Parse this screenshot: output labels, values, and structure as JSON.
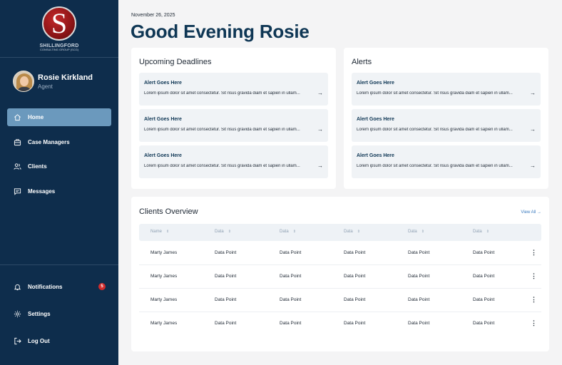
{
  "brand": {
    "logo_letter": "S",
    "logo_name": "SHILLINGFORD",
    "logo_sub": "CONSULTING GROUP (SCG)"
  },
  "profile": {
    "name": "Rosie Kirkland",
    "role": "Agent"
  },
  "nav": {
    "home": "Home",
    "case_managers": "Case Managers",
    "clients": "Clients",
    "messages": "Messages",
    "notifications": "Notifications",
    "notifications_count": "5",
    "settings": "Settings",
    "logout": "Log Out"
  },
  "header": {
    "date": "November 26, 2025",
    "greeting": "Good Evening Rosie"
  },
  "deadlines": {
    "title": "Upcoming Deadlines",
    "items": [
      {
        "title": "Alert Goes Here",
        "body": "Lorem ipsum dolor sit amet consectetur. Sit risus gravida diam et sapien in ullam..."
      },
      {
        "title": "Alert Goes Here",
        "body": "Lorem ipsum dolor sit amet consectetur. Sit risus gravida diam et sapien in ullam..."
      },
      {
        "title": "Alert Goes Here",
        "body": "Lorem ipsum dolor sit amet consectetur. Sit risus gravida diam et sapien in ullam..."
      }
    ]
  },
  "alerts": {
    "title": "Alerts",
    "items": [
      {
        "title": "Alert Goes Here",
        "body": "Lorem ipsum dolor sit amet consectetur. Sit risus gravida diam et sapien in ullam..."
      },
      {
        "title": "Alert Goes Here",
        "body": "Lorem ipsum dolor sit amet consectetur. Sit risus gravida diam et sapien in ullam..."
      },
      {
        "title": "Alert Goes Here",
        "body": "Lorem ipsum dolor sit amet consectetur. Sit risus gravida diam et sapien in ullam..."
      }
    ]
  },
  "clients_overview": {
    "title": "Clients Overview",
    "view_all": "View All",
    "columns": [
      "Name",
      "Data",
      "Data",
      "Data",
      "Data",
      "Data"
    ],
    "rows": [
      [
        "Marty James",
        "Data Point",
        "Data Point",
        "Data Point",
        "Data Point",
        "Data Point"
      ],
      [
        "Marty James",
        "Data Point",
        "Data Point",
        "Data Point",
        "Data Point",
        "Data Point"
      ],
      [
        "Marty James",
        "Data Point",
        "Data Point",
        "Data Point",
        "Data Point",
        "Data Point"
      ],
      [
        "Marty James",
        "Data Point",
        "Data Point",
        "Data Point",
        "Data Point",
        "Data Point"
      ]
    ]
  },
  "colors": {
    "sidebar": "#0e2d4c",
    "active_nav": "#6b99bd",
    "accent": "#0e3654",
    "link": "#3a7bbf",
    "badge": "#d12b2b"
  }
}
